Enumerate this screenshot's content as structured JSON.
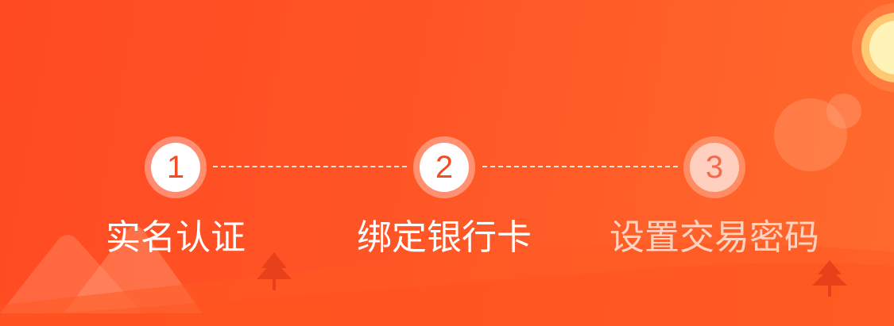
{
  "steps": [
    {
      "number": "1",
      "label": "实名认证",
      "state": "done"
    },
    {
      "number": "2",
      "label": "绑定银行卡",
      "state": "active"
    },
    {
      "number": "3",
      "label": "设置交易密码",
      "state": "pending"
    }
  ],
  "colors": {
    "background_start": "#ff4a22",
    "background_end": "#ff6a2c",
    "step_number": "#f04e24",
    "pending_circle": "#ffd0c0",
    "pending_label": "#ffd3c2",
    "sun": "#fff2b0"
  },
  "decor": {
    "sun": "sun-icon",
    "trees": "tree-icon",
    "mountains": "mountain-icon"
  }
}
